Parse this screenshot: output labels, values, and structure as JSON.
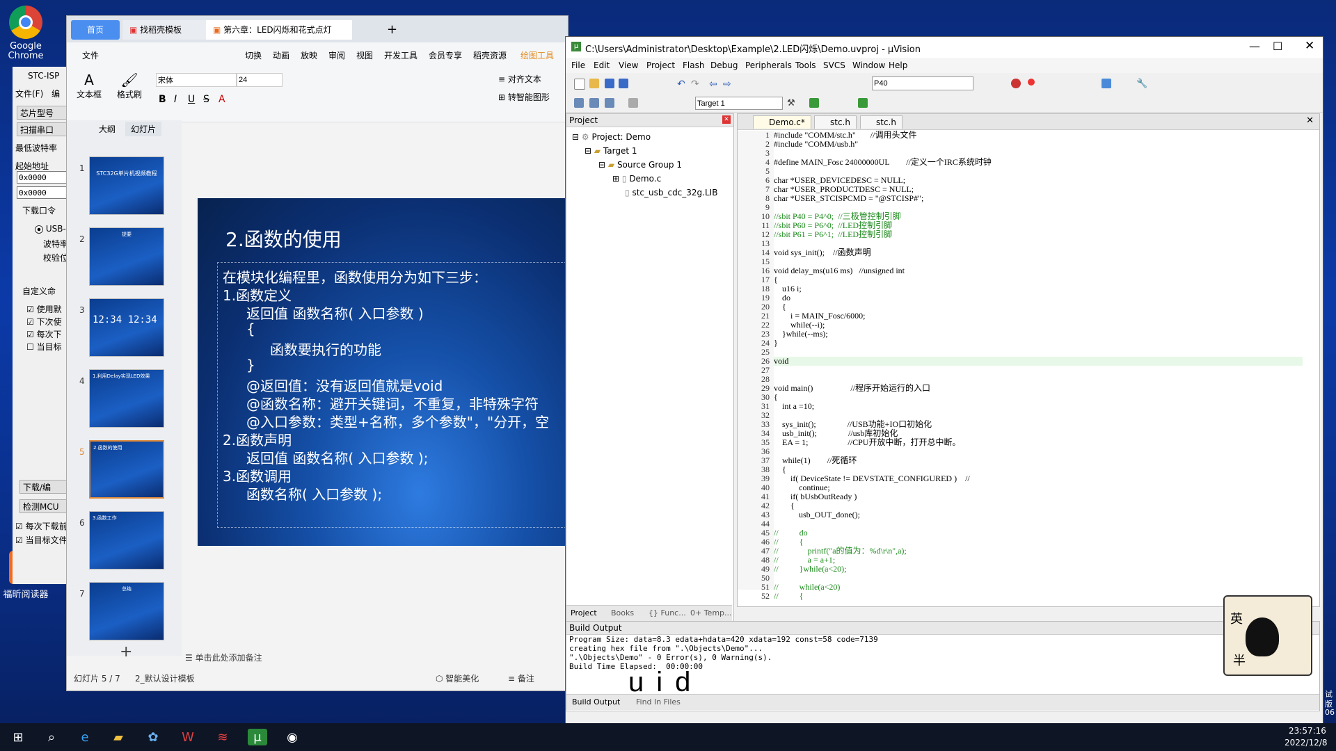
{
  "desktop": {
    "icons": [
      {
        "label": "Google Chrome"
      },
      {
        "label": "福昕阅读器"
      }
    ],
    "right_edge_text": [
      "试",
      "版",
      "06"
    ]
  },
  "taskbar": {
    "time": "23:57:16",
    "date": "2022/12/8"
  },
  "stc_isp": {
    "title": "STC-ISP",
    "menu_file": "文件(F)",
    "menu_edit": "编",
    "chip_button": "芯片型号",
    "scan_button": "扫描串口",
    "min_baud": "最低波特率",
    "start_addr_label": "起始地址",
    "addr1": "0x0000",
    "addr2": "0x0000",
    "download_cmd": "下载口令",
    "usb_option": "USB-",
    "baud": "波特率",
    "check": "校验位",
    "custom_cmd": "自定义命",
    "check_items": [
      "使用默",
      "下次使",
      "每次下",
      "当目标"
    ],
    "download_button": "下载/编",
    "detect_button": "检测MCU",
    "bottom_checks": [
      "每次下载前",
      "当目标文件"
    ]
  },
  "wps": {
    "tabs": [
      {
        "label": "首页"
      },
      {
        "label": "找稻壳模板"
      },
      {
        "label": "第六章：LED闪烁和花式点灯"
      }
    ],
    "menu": [
      "文件",
      "切换",
      "动画",
      "放映",
      "审阅",
      "视图",
      "开发工具",
      "会员专享",
      "稻壳资源",
      "绘图工具"
    ],
    "font_name": "宋体",
    "font_size": "24",
    "ribbon_left": [
      "文本框",
      "格式刷"
    ],
    "ribbon_right": [
      "对齐文本",
      "转智能图形"
    ],
    "panel_tabs": [
      "大纲",
      "幻灯片"
    ],
    "thumbs": [
      {
        "num": "1",
        "text": "STC32G单片机视频教程"
      },
      {
        "num": "2",
        "text": "提要"
      },
      {
        "num": "3",
        "text": "12:34 12:34"
      },
      {
        "num": "4",
        "text": "1.利用Delay实现LED效果"
      },
      {
        "num": "5",
        "text": "2.函数的使用"
      },
      {
        "num": "6",
        "text": "3.函数工作"
      },
      {
        "num": "7",
        "text": "总结"
      }
    ],
    "slide": {
      "title": "2.函数的使用",
      "lines": [
        "在模块化编程里，函数使用分为如下三步：",
        "1.函数定义",
        "返回值 函数名称( 入口参数 )",
        "{",
        "函数要执行的功能",
        "}",
        "@返回值：没有返回值就是void",
        "@函数名称：避开关键词，不重复，非特殊字符",
        "@入口参数：类型+名称，多个参数\"，\"分开，空",
        "2.函数声明",
        "返回值 函数名称( 入口参数 );",
        "3.函数调用",
        "函数名称( 入口参数 );"
      ]
    },
    "notes_placeholder": "单击此处添加备注",
    "status_slide": "幻灯片 5 / 7",
    "status_theme": "2_默认设计模板",
    "status_beautify": "智能美化",
    "status_notes": "备注"
  },
  "keil": {
    "title": "C:\\Users\\Administrator\\Desktop\\Example\\2.LED闪烁\\Demo.uvproj - µVision",
    "menu": [
      "File",
      "Edit",
      "View",
      "Project",
      "Flash",
      "Debug",
      "Peripherals",
      "Tools",
      "SVCS",
      "Window",
      "Help"
    ],
    "search_field": "P40",
    "target_select": "Target 1",
    "project_panel_title": "Project",
    "tree": {
      "root": "Project: Demo",
      "target": "Target 1",
      "group": "Source Group 1",
      "files": [
        "Demo.c",
        "stc_usb_cdc_32g.LIB"
      ]
    },
    "panel_tabs": [
      "Project",
      "Books",
      "{} Func...",
      "0+ Temp..."
    ],
    "editor_tabs": [
      "Demo.c*",
      "stc.h",
      "stc.h"
    ],
    "code": [
      {
        "n": "1",
        "t": "#include \"COMM/stc.h\"       //调用头文件"
      },
      {
        "n": "2",
        "t": "#include \"COMM/usb.h\""
      },
      {
        "n": "3",
        "t": ""
      },
      {
        "n": "4",
        "t": "#define MAIN_Fosc 24000000UL        //定义一个IRC系统时钟"
      },
      {
        "n": "5",
        "t": ""
      },
      {
        "n": "6",
        "t": "char *USER_DEVICEDESC = NULL;"
      },
      {
        "n": "7",
        "t": "char *USER_PRODUCTDESC = NULL;"
      },
      {
        "n": "8",
        "t": "char *USER_STCISPCMD = \"@STCISP#\";"
      },
      {
        "n": "9",
        "t": ""
      },
      {
        "n": "10",
        "t": "//sbit P40 = P4^0;  //三极管控制引脚"
      },
      {
        "n": "11",
        "t": "//sbit P60 = P6^0;  //LED控制引脚"
      },
      {
        "n": "12",
        "t": "//sbit P61 = P6^1;  //LED控制引脚"
      },
      {
        "n": "13",
        "t": ""
      },
      {
        "n": "14",
        "t": "void sys_init();    //函数声明"
      },
      {
        "n": "15",
        "t": ""
      },
      {
        "n": "16",
        "t": "void delay_ms(u16 ms)   //unsigned int"
      },
      {
        "n": "17",
        "t": "{"
      },
      {
        "n": "18",
        "t": "    u16 i;"
      },
      {
        "n": "19",
        "t": "    do"
      },
      {
        "n": "20",
        "t": "    {"
      },
      {
        "n": "21",
        "t": "        i = MAIN_Fosc/6000;"
      },
      {
        "n": "22",
        "t": "        while(--i);"
      },
      {
        "n": "23",
        "t": "    }while(--ms);"
      },
      {
        "n": "24",
        "t": "}"
      },
      {
        "n": "25",
        "t": ""
      },
      {
        "n": "26",
        "t": "void"
      },
      {
        "n": "27",
        "t": ""
      },
      {
        "n": "28",
        "t": ""
      },
      {
        "n": "29",
        "t": "void main()                  //程序开始运行的入口"
      },
      {
        "n": "30",
        "t": "{"
      },
      {
        "n": "31",
        "t": "    int a =10;"
      },
      {
        "n": "32",
        "t": ""
      },
      {
        "n": "33",
        "t": "    sys_init();               //USB功能+IO口初始化"
      },
      {
        "n": "34",
        "t": "    usb_init();               //usb库初始化"
      },
      {
        "n": "35",
        "t": "    EA = 1;                   //CPU开放中断，打开总中断。"
      },
      {
        "n": "36",
        "t": ""
      },
      {
        "n": "37",
        "t": "    while(1)        //死循环"
      },
      {
        "n": "38",
        "t": "    {"
      },
      {
        "n": "39",
        "t": "        if( DeviceState != DEVSTATE_CONFIGURED )    //"
      },
      {
        "n": "40",
        "t": "            continue;"
      },
      {
        "n": "41",
        "t": "        if( bUsbOutReady )"
      },
      {
        "n": "42",
        "t": "        {"
      },
      {
        "n": "43",
        "t": "            usb_OUT_done();"
      },
      {
        "n": "44",
        "t": ""
      },
      {
        "n": "45",
        "t": "//          do"
      },
      {
        "n": "46",
        "t": "//          {"
      },
      {
        "n": "47",
        "t": "//              printf(\"a的值为：%d\\r\\n\",a);"
      },
      {
        "n": "48",
        "t": "//              a = a+1;"
      },
      {
        "n": "49",
        "t": "//          }while(a<20);"
      },
      {
        "n": "50",
        "t": ""
      },
      {
        "n": "51",
        "t": "//          while(a<20)"
      },
      {
        "n": "52",
        "t": "//          {"
      }
    ],
    "build_title": "Build Output",
    "build_lines": [
      "Program Size: data=8.3 edata+hdata=420 xdata=192 const=58 code=7139",
      "creating hex file from \".\\Objects\\Demo\"...",
      "\".\\Objects\\Demo\" - 0 Error(s), 0 Warning(s).",
      "Build Time Elapsed:  00:00:00"
    ],
    "build_tabs": [
      "Build Output",
      "Find In Files"
    ],
    "overlay_text": "uid"
  },
  "sticker": {
    "text1": "英",
    "text2": "半"
  }
}
